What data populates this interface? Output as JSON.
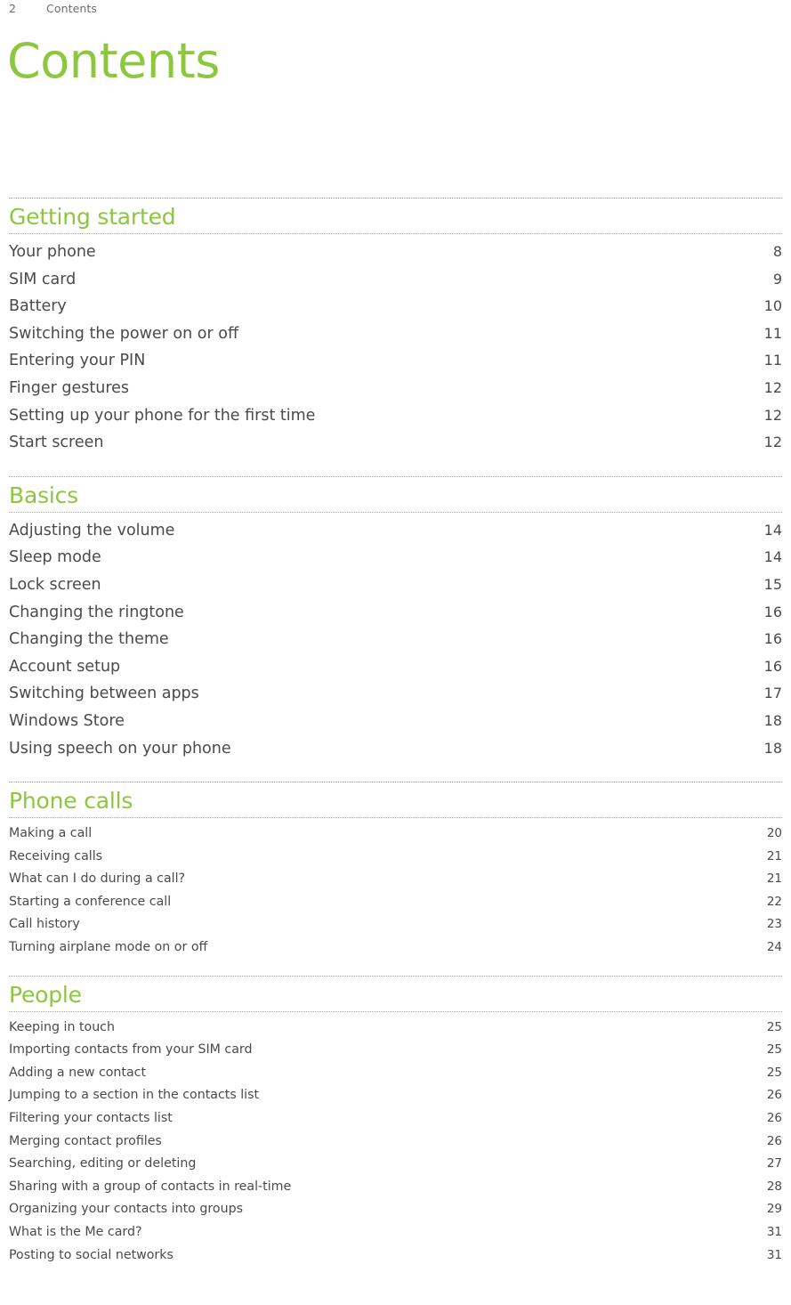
{
  "running_header": {
    "page_number": "2",
    "title": "Contents"
  },
  "page_title": "Contents",
  "colors": {
    "accent": "#8dc63f",
    "body_text": "#4a4a4a",
    "header_text": "#6e6e6e"
  },
  "sections": [
    {
      "heading": "Getting started",
      "size": "big",
      "entries": [
        {
          "label": "Your phone",
          "page": "8"
        },
        {
          "label": "SIM card",
          "page": "9"
        },
        {
          "label": "Battery",
          "page": "10"
        },
        {
          "label": "Switching the power on or off",
          "page": "11"
        },
        {
          "label": "Entering your PIN",
          "page": "11"
        },
        {
          "label": "Finger gestures",
          "page": "12"
        },
        {
          "label": "Setting up your phone for the first time",
          "page": "12"
        },
        {
          "label": "Start screen",
          "page": "12"
        }
      ]
    },
    {
      "heading": "Basics",
      "size": "big",
      "entries": [
        {
          "label": "Adjusting the volume",
          "page": "14"
        },
        {
          "label": "Sleep mode",
          "page": "14"
        },
        {
          "label": "Lock screen",
          "page": "15"
        },
        {
          "label": "Changing the ringtone",
          "page": "16"
        },
        {
          "label": "Changing the theme",
          "page": "16"
        },
        {
          "label": "Account setup",
          "page": "16"
        },
        {
          "label": "Switching between apps",
          "page": "17"
        },
        {
          "label": "Windows Store",
          "page": "18"
        },
        {
          "label": "Using speech on your phone",
          "page": "18"
        }
      ]
    },
    {
      "heading": "Phone calls",
      "size": "small",
      "entries": [
        {
          "label": "Making a call",
          "page": "20"
        },
        {
          "label": "Receiving calls",
          "page": "21"
        },
        {
          "label": "What can I do during a call?",
          "page": "21"
        },
        {
          "label": "Starting a conference call",
          "page": "22"
        },
        {
          "label": "Call history",
          "page": "23"
        },
        {
          "label": "Turning airplane mode on or off",
          "page": "24"
        }
      ]
    },
    {
      "heading": "People",
      "size": "small",
      "entries": [
        {
          "label": "Keeping in touch",
          "page": "25"
        },
        {
          "label": "Importing contacts from your SIM card",
          "page": "25"
        },
        {
          "label": "Adding a new contact",
          "page": "25"
        },
        {
          "label": "Jumping to a section in the contacts list",
          "page": "26"
        },
        {
          "label": "Filtering your contacts list",
          "page": "26"
        },
        {
          "label": "Merging contact profiles",
          "page": "26"
        },
        {
          "label": "Searching, editing or deleting",
          "page": "27"
        },
        {
          "label": "Sharing with a group of contacts in real-time",
          "page": "28"
        },
        {
          "label": "Organizing your contacts into groups",
          "page": "29"
        },
        {
          "label": "What is the Me card?",
          "page": "31"
        },
        {
          "label": "Posting to social networks",
          "page": "31"
        }
      ]
    }
  ]
}
